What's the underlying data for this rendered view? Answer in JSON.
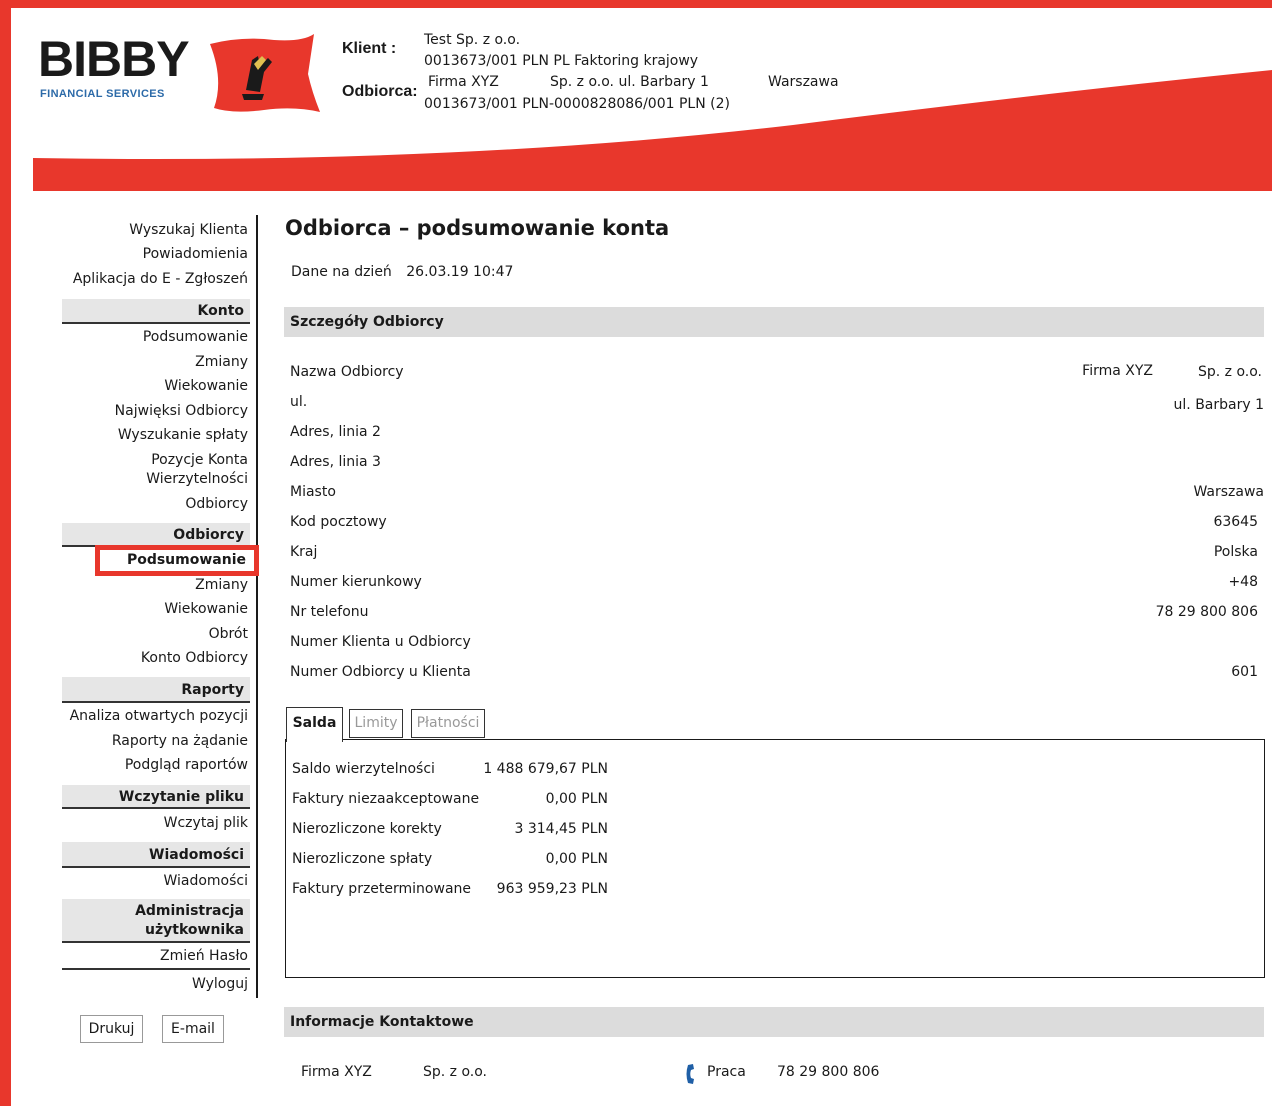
{
  "brand": {
    "name": "BIBBY",
    "tagline": "FINANCIAL SERVICES"
  },
  "header": {
    "client_label": "Klient :",
    "client_name": "Test Sp. z o.o.",
    "client_account": "0013673/001 PLN PL Faktoring krajowy",
    "debtor_label": "Odbiorca:",
    "debtor_name": "Firma XYZ",
    "debtor_company": "Sp. z o.o. ul. Barbary 1",
    "debtor_city": "Warszawa",
    "debtor_account": "0013673/001 PLN-0000828086/001 PLN (2)"
  },
  "sidebar": {
    "top_links": [
      "Wyszukaj Klienta",
      "Powiadomienia",
      "Aplikacja do E - Zgłoszeń"
    ],
    "konto": {
      "title": "Konto",
      "items": [
        "Podsumowanie",
        "Zmiany",
        "Wiekowanie",
        "Najwięksi Odbiorcy",
        "Wyszukanie spłaty",
        "Pozycje Konta",
        "Wierzytelności",
        "Odbiorcy"
      ]
    },
    "odbiorcy": {
      "title": "Odbiorcy",
      "active": "Podsumowanie",
      "items": [
        "Zmiany",
        "Wiekowanie",
        "Obrót",
        "Konto Odbiorcy"
      ]
    },
    "raporty": {
      "title": "Raporty",
      "items": [
        "Analiza otwartych pozycji",
        "Raporty na żądanie",
        "Podgląd raportów"
      ]
    },
    "wczytanie": {
      "title": "Wczytanie pliku",
      "items": [
        "Wczytaj plik"
      ]
    },
    "wiadomosci": {
      "title": "Wiadomości",
      "items": [
        "Wiadomości"
      ]
    },
    "admin": {
      "title_1": "Administracja",
      "title_2": "użytkownika",
      "items": [
        "Zmień Hasło",
        "Wyloguj"
      ]
    },
    "buttons": {
      "print": "Drukuj",
      "email": "E-mail"
    }
  },
  "main": {
    "title": "Odbiorca – podsumowanie konta",
    "date_label": "Dane na dzień",
    "date_value": "26.03.19 10:47",
    "details": {
      "heading": "Szczegóły Odbiorcy",
      "rows": [
        {
          "label": "Nazwa Odbiorcy",
          "value": "Firma XYZ",
          "value2": "Sp. z o.o."
        },
        {
          "label": "ul.",
          "value": "ul. Barbary 1"
        },
        {
          "label": "Adres, linia 2",
          "value": ""
        },
        {
          "label": "Adres, linia 3",
          "value": ""
        },
        {
          "label": "Miasto",
          "value": "Warszawa"
        },
        {
          "label": "Kod pocztowy",
          "value": "63645"
        },
        {
          "label": "Kraj",
          "value": "Polska"
        },
        {
          "label": "Numer kierunkowy",
          "value": "+48"
        },
        {
          "label": "Nr telefonu",
          "value": "78 29 800 806"
        },
        {
          "label": "Numer Klienta u Odbiorcy",
          "value": ""
        },
        {
          "label": "Numer Odbiorcy u Klienta",
          "value": "601"
        }
      ]
    },
    "tabs": [
      "Salda",
      "Limity",
      "Płatności"
    ],
    "balances": [
      {
        "label": "Saldo wierzytelności",
        "value": "1 488 679,67 PLN"
      },
      {
        "label": "Faktury niezaakceptowane",
        "value": "0,00 PLN"
      },
      {
        "label": "Nierozliczone korekty",
        "value": "3 314,45 PLN"
      },
      {
        "label": "Nierozliczone spłaty",
        "value": "0,00 PLN"
      },
      {
        "label": "Faktury przeterminowane",
        "value": "963 959,23 PLN"
      }
    ],
    "contact": {
      "heading": "Informacje Kontaktowe",
      "name": "Firma XYZ",
      "company": "Sp. z o.o.",
      "phone_type": "Praca",
      "phone": "78 29 800 806"
    }
  },
  "colors": {
    "brand_red": "#e8372c",
    "logo_blue": "#2c6aa8",
    "panel_grey": "#dcdcdc"
  },
  "icons": {
    "phone": "phone-icon",
    "logo": "bibby-flag-logo"
  }
}
